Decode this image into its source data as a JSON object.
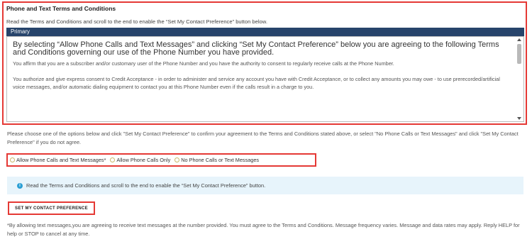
{
  "terms": {
    "title": "Phone and Text Terms and Conditions",
    "instruction": "Read the Terms and Conditions and scroll to the end to enable the “Set My Contact Preference” button below.",
    "tab_label": "Primary",
    "heading": "By selecting “Allow Phone Calls and Text Messages” and clicking “Set My Contact Preference” below you are agreeing to the following Terms and Conditions governing our use of the Phone Number you have provided.",
    "paragraph1": "You affirm that you are a subscriber and/or customary user of the Phone Number and you have the authority to consent to regularly receive calls at the Phone Number.",
    "paragraph2": "You authorize and give express consent to Credit Acceptance - in order to administer and service any account you have with Credit Acceptance, or to collect any amounts you may owe - to use prerecorded/artificial voice messages, and/or automatic dialing equipment to contact you at this Phone Number even if the calls result in a charge to you."
  },
  "choose_text": "Please choose one of the options below and click \"Set My Contact Preference\" to confirm your agreement to the Terms and Conditions stated above, or select \"No Phone Calls or Text Messages\" and click \"Set My Contact Preference\" if you do not agree.",
  "options": [
    {
      "label": "Allow Phone Calls and Text Messages*"
    },
    {
      "label": "Allow Phone Calls Only"
    },
    {
      "label": "No Phone Calls or Text Messages"
    }
  ],
  "info_message": "Read the Terms and Conditions and scroll to the end to enable the “Set My Contact Preference” button.",
  "submit_label": "SET MY CONTACT PREFERENCE",
  "disclaimer": "*By allowing text messages,you are agreeing to receive text messages at the number provided. You must agree to the Terms and Conditions. Message frequency varies. Message and data rates may apply. Reply HELP for help or STOP to cancel at any time.",
  "colors": {
    "highlight": "#e53935",
    "primary_bar": "#27446b",
    "info_bg": "#e7f4fb"
  }
}
